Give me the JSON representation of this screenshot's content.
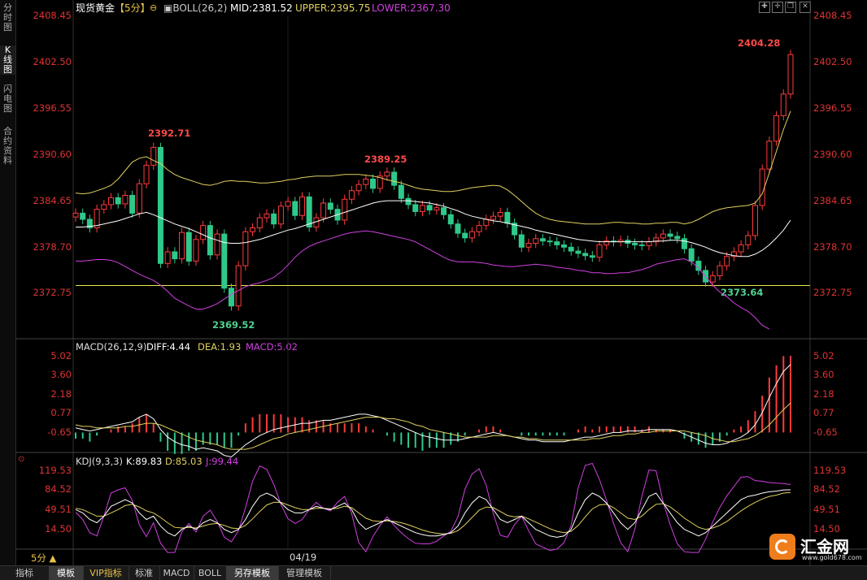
{
  "sidebar": {
    "tabs": [
      {
        "label": "分\n时\n图",
        "active": false
      },
      {
        "label": "K\n线\n图",
        "active": true
      },
      {
        "label": "闪\n电\n图",
        "active": false
      },
      {
        "label": "合\n约\n资\n料",
        "active": false
      }
    ]
  },
  "header": {
    "symbol": "现货黄金",
    "period": "【5分】",
    "indicator": "BOLL(26,2)",
    "mid": "MID:2381.52",
    "upper": "UPPER:2395.75",
    "lower": "LOWER:2367.30"
  },
  "price_axis": {
    "ticks": [
      "2408.45",
      "2402.50",
      "2396.55",
      "2390.60",
      "2384.65",
      "2378.70",
      "2372.75"
    ]
  },
  "price_annotations": {
    "high_left": "2392.71",
    "high_mid": "2389.25",
    "low_left": "2369.52",
    "low_right": "2373.64",
    "high_right": "2404.28"
  },
  "macd": {
    "title": "MACD(26,12,9)",
    "diff": "DIFF:4.44",
    "dea": "DEA:1.93",
    "macd": "MACD:5.02",
    "ticks": [
      "5.02",
      "3.60",
      "2.18",
      "0.77",
      "-0.65"
    ]
  },
  "kdj": {
    "title": "KDJ(9,3,3)",
    "k": "K:89.83",
    "d": "D:85.03",
    "j": "J:99.44",
    "ticks": [
      "119.53",
      "84.52",
      "49.51",
      "14.50"
    ]
  },
  "date_label": "04/19",
  "period_label": "5分 ▲",
  "bottom_tabs": [
    {
      "label": "指标",
      "active": false
    },
    {
      "label": "模板",
      "active": true
    },
    {
      "label": "VIP指标",
      "active": false
    },
    {
      "label": "标准",
      "active": false
    },
    {
      "label": "MACD",
      "active": false
    },
    {
      "label": "BOLL",
      "active": false
    },
    {
      "label": "另存模板",
      "active": true
    },
    {
      "label": "管理模板",
      "active": false
    }
  ],
  "logo": {
    "name": "汇金网",
    "url": "www.gold678.com"
  },
  "colors": {
    "up": "#ff3b3b",
    "down": "#2ec98a",
    "upper": "#e0d060",
    "lower": "#d040e0",
    "mid": "#ffffff",
    "support": "#e8e850"
  },
  "chart_data": [
    {
      "type": "candlestick",
      "title": "现货黄金【5分】",
      "indicators": [
        "BOLL(26,2)"
      ],
      "ylim": [
        2368.0,
        2408.45
      ],
      "support_line": 2373.64,
      "close": [
        2383.0,
        2382.2,
        2381.1,
        2383.5,
        2384.1,
        2385.0,
        2384.2,
        2385.3,
        2383.0,
        2386.8,
        2389.2,
        2391.5,
        2376.5,
        2378.0,
        2377.1,
        2380.5,
        2376.8,
        2379.6,
        2381.4,
        2377.6,
        2380.3,
        2373.3,
        2371.0,
        2376.2,
        2380.6,
        2381.1,
        2382.4,
        2382.9,
        2381.6,
        2383.9,
        2384.5,
        2382.7,
        2385.1,
        2381.2,
        2382.4,
        2384.3,
        2383.5,
        2382.1,
        2384.8,
        2385.9,
        2386.7,
        2387.4,
        2386.2,
        2387.8,
        2388.3,
        2386.6,
        2384.9,
        2384.1,
        2383.2,
        2384.0,
        2383.4,
        2383.7,
        2382.8,
        2381.6,
        2380.4,
        2379.8,
        2380.6,
        2381.4,
        2382.2,
        2382.6,
        2383.1,
        2381.7,
        2380.2,
        2378.6,
        2379.1,
        2379.7,
        2379.4,
        2379.3,
        2378.9,
        2378.6,
        2378.1,
        2377.8,
        2377.5,
        2377.3,
        2378.9,
        2379.4,
        2379.3,
        2379.5,
        2379.1,
        2378.9,
        2378.8,
        2379.3,
        2379.8,
        2380.3,
        2380.0,
        2379.7,
        2378.4,
        2376.8,
        2375.6,
        2374.1,
        2374.9,
        2376.2,
        2377.4,
        2378.0,
        2378.9,
        2380.1,
        2384.0,
        2388.7,
        2392.3,
        2395.6,
        2398.4,
        2403.5
      ],
      "boll_mid": [
        2381.2,
        2381.2,
        2381.3,
        2381.4,
        2381.6,
        2381.8,
        2382.0,
        2382.3,
        2382.6,
        2382.9,
        2383.1,
        2382.8,
        2382.4,
        2382.0,
        2381.6,
        2381.3,
        2381.0,
        2380.6,
        2380.2,
        2379.8,
        2379.5,
        2379.2,
        2379.1,
        2379.1,
        2379.2,
        2379.4,
        2379.6,
        2379.9,
        2380.2,
        2380.5,
        2380.8,
        2381.0,
        2381.3,
        2381.6,
        2381.9,
        2382.2,
        2382.5,
        2382.8,
        2383.1,
        2383.4,
        2383.7,
        2384.0,
        2384.3,
        2384.5,
        2384.6,
        2384.6,
        2384.6,
        2384.6,
        2384.5,
        2384.4,
        2384.3,
        2384.1,
        2383.9,
        2383.6,
        2383.3,
        2382.9,
        2382.6,
        2382.4,
        2382.2,
        2382.0,
        2381.9,
        2381.7,
        2381.5,
        2381.3,
        2381.1,
        2380.8,
        2380.6,
        2380.4,
        2380.2,
        2380.0,
        2379.8,
        2379.6,
        2379.5,
        2379.4,
        2379.3,
        2379.3,
        2379.3,
        2379.3,
        2379.3,
        2379.3,
        2379.3,
        2379.3,
        2379.4,
        2379.4,
        2379.5,
        2379.5,
        2379.4,
        2379.2,
        2378.9,
        2378.6,
        2378.2,
        2377.9,
        2377.7,
        2377.5,
        2377.4,
        2377.4,
        2377.7,
        2378.2,
        2378.9,
        2379.8,
        2380.8,
        2382.1
      ],
      "boll_upper": [
        2385.6,
        2385.5,
        2385.6,
        2385.9,
        2386.2,
        2386.6,
        2387.4,
        2388.5,
        2389.6,
        2390.1,
        2390.3,
        2389.8,
        2389.4,
        2388.6,
        2388.0,
        2387.6,
        2387.3,
        2387.0,
        2386.7,
        2386.6,
        2386.8,
        2387.1,
        2387.2,
        2387.1,
        2387.1,
        2387.0,
        2386.9,
        2386.9,
        2387.0,
        2387.1,
        2387.3,
        2387.4,
        2387.6,
        2387.7,
        2387.8,
        2387.8,
        2387.8,
        2387.9,
        2388.0,
        2388.0,
        2388.0,
        2387.9,
        2387.8,
        2387.6,
        2387.3,
        2387.1,
        2386.9,
        2386.6,
        2386.3,
        2386.1,
        2386.0,
        2385.9,
        2385.8,
        2385.8,
        2385.9,
        2386.1,
        2386.3,
        2386.4,
        2386.5,
        2386.6,
        2386.5,
        2386.0,
        2385.3,
        2384.5,
        2383.7,
        2383.0,
        2382.5,
        2382.2,
        2382.0,
        2381.9,
        2381.8,
        2381.7,
        2381.6,
        2381.6,
        2381.6,
        2381.7,
        2381.8,
        2381.8,
        2381.7,
        2381.7,
        2381.6,
        2381.6,
        2381.7,
        2381.7,
        2381.8,
        2381.8,
        2381.6,
        2381.8,
        2382.2,
        2382.7,
        2383.2,
        2383.5,
        2383.7,
        2383.8,
        2383.9,
        2384.0,
        2384.3,
        2385.5,
        2388.2,
        2391.0,
        2393.8,
        2396.2
      ],
      "boll_lower": [
        2376.8,
        2376.8,
        2376.9,
        2377.0,
        2377.0,
        2376.9,
        2376.6,
        2376.1,
        2375.6,
        2375.1,
        2374.7,
        2374.3,
        2373.7,
        2372.9,
        2372.0,
        2371.5,
        2371.0,
        2370.6,
        2370.6,
        2370.9,
        2371.3,
        2371.9,
        2372.5,
        2373.0,
        2373.5,
        2373.8,
        2374.0,
        2374.3,
        2374.7,
        2375.4,
        2376.3,
        2377.3,
        2378.1,
        2378.7,
        2379.1,
        2379.4,
        2379.7,
        2380.0,
        2380.3,
        2380.5,
        2380.6,
        2380.7,
        2380.6,
        2380.4,
        2380.2,
        2380.0,
        2379.8,
        2379.6,
        2379.3,
        2378.8,
        2378.3,
        2377.8,
        2377.3,
        2376.9,
        2376.7,
        2376.7,
        2376.7,
        2376.6,
        2376.5,
        2376.3,
        2376.2,
        2376.1,
        2376.1,
        2376.2,
        2376.3,
        2376.4,
        2376.3,
        2376.2,
        2376.0,
        2375.9,
        2375.8,
        2375.6,
        2375.5,
        2375.3,
        2375.3,
        2375.2,
        2375.2,
        2375.3,
        2375.3,
        2375.5,
        2375.7,
        2376.0,
        2376.4,
        2376.6,
        2376.8,
        2377.0,
        2377.1,
        2376.7,
        2375.9,
        2374.8,
        2373.7,
        2372.8,
        2372.2,
        2371.4,
        2370.8,
        2370.3,
        2369.5,
        2368.5,
        2368.0
      ]
    },
    {
      "type": "macd",
      "title": "MACD(26,12,9)",
      "ylim": [
        -1.2,
        5.02
      ],
      "diff": [
        0.3,
        0.2,
        0.1,
        0.2,
        0.3,
        0.4,
        0.5,
        0.6,
        0.7,
        1.0,
        1.2,
        0.9,
        0.2,
        -0.3,
        -0.6,
        -0.8,
        -0.9,
        -1.1,
        -1.0,
        -1.1,
        -1.2,
        -1.5,
        -1.6,
        -1.2,
        -0.8,
        -0.5,
        -0.2,
        0.0,
        0.2,
        0.3,
        0.4,
        0.5,
        0.6,
        0.6,
        0.7,
        0.8,
        0.8,
        0.9,
        1.0,
        1.1,
        1.2,
        1.2,
        1.1,
        1.0,
        0.8,
        0.6,
        0.4,
        0.2,
        0.0,
        -0.2,
        -0.3,
        -0.4,
        -0.5,
        -0.5,
        -0.5,
        -0.4,
        -0.3,
        -0.2,
        -0.1,
        0.0,
        -0.1,
        -0.2,
        -0.3,
        -0.4,
        -0.5,
        -0.5,
        -0.6,
        -0.6,
        -0.6,
        -0.6,
        -0.5,
        -0.4,
        -0.3,
        -0.3,
        -0.2,
        -0.1,
        0.0,
        0.0,
        0.1,
        0.1,
        0.1,
        0.2,
        0.2,
        0.2,
        0.2,
        0.1,
        -0.1,
        -0.3,
        -0.5,
        -0.7,
        -0.8,
        -0.8,
        -0.7,
        -0.5,
        -0.3,
        0.0,
        0.5,
        1.3,
        2.3,
        3.2,
        4.0,
        4.44
      ],
      "dea": [
        0.5,
        0.4,
        0.4,
        0.3,
        0.3,
        0.3,
        0.3,
        0.4,
        0.4,
        0.5,
        0.6,
        0.6,
        0.5,
        0.3,
        0.1,
        -0.1,
        -0.3,
        -0.5,
        -0.6,
        -0.7,
        -0.8,
        -1.0,
        -1.1,
        -1.1,
        -1.1,
        -1.0,
        -0.8,
        -0.6,
        -0.4,
        -0.3,
        -0.1,
        0.0,
        0.1,
        0.2,
        0.3,
        0.4,
        0.5,
        0.6,
        0.7,
        0.8,
        0.9,
        1.0,
        1.0,
        1.0,
        0.9,
        0.9,
        0.8,
        0.7,
        0.5,
        0.4,
        0.2,
        0.1,
        0.0,
        -0.1,
        -0.2,
        -0.3,
        -0.3,
        -0.3,
        -0.3,
        -0.2,
        -0.2,
        -0.2,
        -0.3,
        -0.3,
        -0.4,
        -0.4,
        -0.5,
        -0.5,
        -0.5,
        -0.5,
        -0.5,
        -0.5,
        -0.5,
        -0.4,
        -0.4,
        -0.3,
        -0.2,
        -0.2,
        -0.1,
        -0.1,
        0.0,
        0.0,
        0.1,
        0.1,
        0.1,
        0.1,
        0.1,
        0.0,
        -0.1,
        -0.2,
        -0.4,
        -0.5,
        -0.6,
        -0.6,
        -0.5,
        -0.4,
        -0.2,
        0.1,
        0.5,
        1.0,
        1.5,
        1.93
      ]
    },
    {
      "type": "kdj",
      "title": "KDJ(9,3,3)",
      "ylim": [
        0,
        130
      ],
      "k": [
        60,
        55,
        45,
        40,
        50,
        65,
        70,
        75,
        70,
        55,
        45,
        50,
        35,
        25,
        20,
        30,
        35,
        30,
        40,
        45,
        40,
        30,
        25,
        30,
        45,
        65,
        80,
        85,
        80,
        70,
        60,
        55,
        55,
        60,
        65,
        62,
        60,
        65,
        70,
        60,
        40,
        30,
        35,
        40,
        45,
        40,
        35,
        30,
        25,
        22,
        20,
        20,
        22,
        25,
        35,
        55,
        70,
        80,
        75,
        60,
        45,
        40,
        45,
        50,
        40,
        30,
        25,
        20,
        18,
        20,
        30,
        55,
        75,
        85,
        80,
        70,
        55,
        40,
        30,
        40,
        60,
        80,
        85,
        70,
        55,
        40,
        30,
        25,
        20,
        25,
        35,
        45,
        55,
        65,
        75,
        80,
        82,
        85,
        87,
        88,
        89.83,
        90
      ],
      "d": [
        62,
        60,
        55,
        50,
        50,
        55,
        60,
        66,
        68,
        64,
        58,
        55,
        48,
        40,
        33,
        32,
        33,
        32,
        35,
        38,
        39,
        36,
        32,
        31,
        36,
        46,
        57,
        67,
        71,
        71,
        67,
        63,
        60,
        60,
        62,
        62,
        61,
        62,
        65,
        63,
        55,
        47,
        43,
        42,
        43,
        42,
        40,
        37,
        33,
        29,
        26,
        24,
        23,
        24,
        28,
        37,
        48,
        59,
        64,
        63,
        57,
        51,
        49,
        50,
        46,
        41,
        36,
        31,
        27,
        25,
        27,
        36,
        49,
        61,
        67,
        68,
        63,
        55,
        47,
        45,
        50,
        60,
        68,
        69,
        64,
        56,
        47,
        40,
        33,
        30,
        32,
        36,
        42,
        50,
        58,
        65,
        71,
        76,
        80,
        82,
        85.03,
        86
      ],
      "j": [
        56,
        45,
        25,
        20,
        50,
        85,
        90,
        93,
        74,
        37,
        19,
        40,
        9,
        -5,
        -6,
        26,
        39,
        26,
        50,
        59,
        42,
        18,
        11,
        28,
        63,
        103,
        126,
        121,
        98,
        68,
        46,
        39,
        45,
        60,
        71,
        62,
        58,
        71,
        80,
        54,
        10,
        -4,
        19,
        36,
        49,
        36,
        25,
        16,
        9,
        8,
        8,
        12,
        20,
        27,
        49,
        91,
        114,
        122,
        97,
        54,
        21,
        18,
        37,
        50,
        28,
        8,
        3,
        -2,
        0,
        10,
        36,
        93,
        127,
        133,
        106,
        74,
        39,
        10,
        -4,
        30,
        80,
        120,
        119,
        72,
        37,
        8,
        -4,
        -5,
        -6,
        15,
        41,
        63,
        81,
        95,
        109,
        110,
        104,
        103,
        101,
        100,
        99.44,
        98
      ]
    }
  ]
}
